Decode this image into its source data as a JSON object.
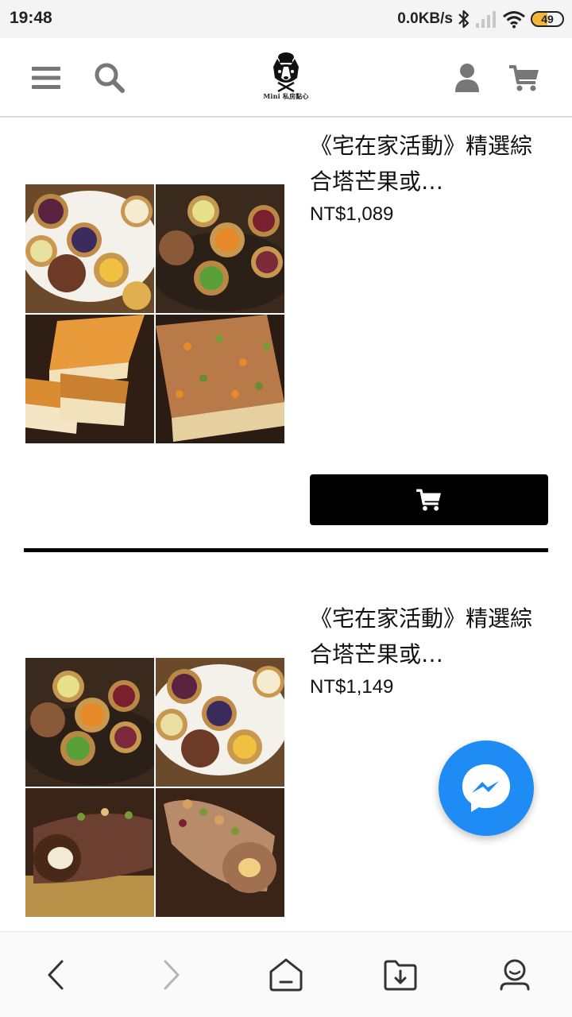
{
  "status_bar": {
    "time": "19:48",
    "net_speed": "0.0KB/s",
    "battery_level": "49",
    "icons": [
      "bluetooth-icon",
      "signal-icon",
      "wifi-icon",
      "battery-icon"
    ]
  },
  "header": {
    "icons": [
      "menu-icon",
      "search-icon",
      "user-icon",
      "cart-icon"
    ],
    "logo_text": "Mini 私房點心"
  },
  "products": [
    {
      "title": "《宅在家活動》精選綜合塔芒果或…",
      "price": "NT$1,089",
      "cart_icon": "cart-icon"
    },
    {
      "title": "《宅在家活動》精選綜合塔芒果或…",
      "price": "NT$1,149"
    }
  ],
  "fab": {
    "icon": "messenger-icon"
  },
  "bottom_nav": {
    "icons": [
      "back-icon",
      "forward-icon",
      "home-icon",
      "downloads-icon",
      "profile-icon"
    ]
  },
  "colors": {
    "accent": "#1f8bf5",
    "battery": "#f2b53a",
    "button": "#000000"
  }
}
